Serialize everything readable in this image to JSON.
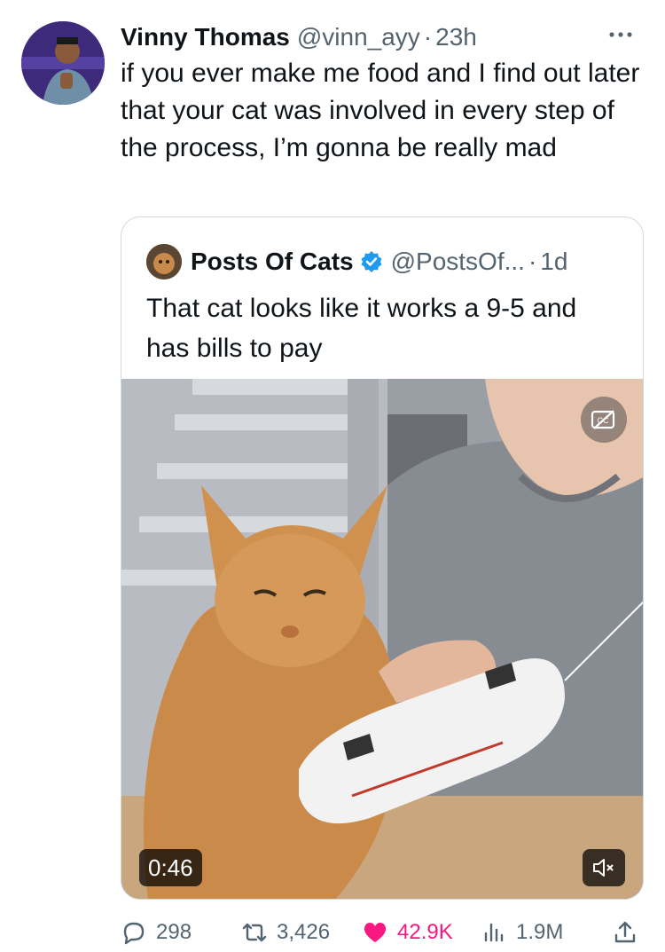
{
  "tweet": {
    "author": {
      "display_name": "Vinny Thomas",
      "handle": "@vinn_ayy",
      "separator": "·",
      "time": "23h"
    },
    "text": "if you ever make me food and I find out later that your cat was involved in every step of the process, I’m gonna be really mad",
    "more_icon": "more-horizontal-icon"
  },
  "quote": {
    "display_name": "Posts Of Cats",
    "verified": true,
    "handle": "@PostsOf...",
    "separator": "·",
    "time": "1d",
    "text": "That cat looks like it works a 9-5 and has bills to pay",
    "media": {
      "type": "video",
      "duration": "0:46",
      "captions_icon": "closed-captions-off-icon",
      "mute_icon": "speaker-muted-icon"
    }
  },
  "actions": {
    "replies": "298",
    "reposts": "3,426",
    "likes": "42.9K",
    "views": "1.9M",
    "share_icon": "share-icon"
  },
  "colors": {
    "text": "#0f1419",
    "secondary": "#536471",
    "border": "#cfd9de",
    "like": "#f91880",
    "verified": "#1d9bf0"
  }
}
